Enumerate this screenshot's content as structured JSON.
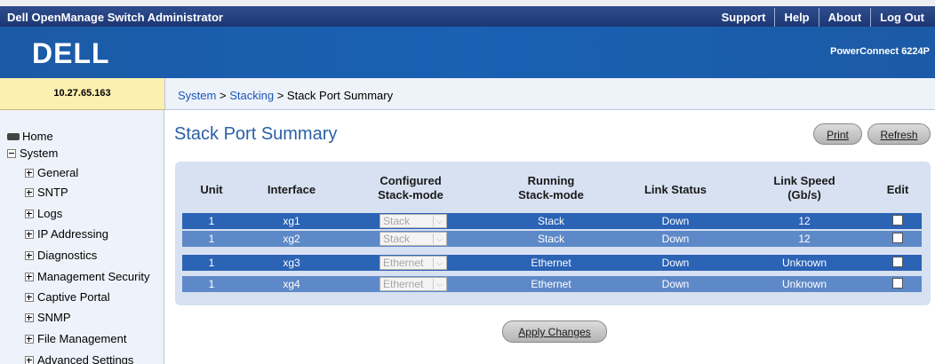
{
  "header": {
    "app_title": "Dell OpenManage Switch Administrator",
    "nav": [
      "Support",
      "Help",
      "About",
      "Log Out"
    ]
  },
  "banner": {
    "logo": "DELL",
    "model": "PowerConnect 6224P"
  },
  "ip_address": "10.27.65.163",
  "breadcrumb": [
    "System",
    "Stacking",
    "Stack Port Summary"
  ],
  "sidebar": {
    "items": [
      {
        "label": "Home",
        "icon": "home-icon"
      },
      {
        "label": "System",
        "icon": "collapse-icon"
      },
      {
        "label": "General",
        "icon": "expand-icon"
      },
      {
        "label": "SNTP",
        "icon": "expand-icon"
      },
      {
        "label": "Logs",
        "icon": "expand-icon"
      },
      {
        "label": "IP Addressing",
        "icon": "expand-icon"
      },
      {
        "label": "Diagnostics",
        "icon": "expand-icon"
      },
      {
        "label": "Management Security",
        "icon": "expand-icon"
      },
      {
        "label": "Captive Portal",
        "icon": "expand-icon"
      },
      {
        "label": "SNMP",
        "icon": "expand-icon"
      },
      {
        "label": "File Management",
        "icon": "expand-icon"
      },
      {
        "label": "Advanced Settings",
        "icon": "expand-icon"
      }
    ]
  },
  "main": {
    "title": "Stack Port Summary",
    "print_label": "Print",
    "refresh_label": "Refresh",
    "apply_label": "Apply Changes",
    "columns": {
      "unit": "Unit",
      "interface": "Interface",
      "configured_1": "Configured",
      "configured_2": "Stack-mode",
      "running_1": "Running",
      "running_2": "Stack-mode",
      "link_status": "Link Status",
      "link_speed_1": "Link Speed",
      "link_speed_2": "(Gb/s)",
      "edit": "Edit"
    },
    "rows": [
      {
        "unit": "1",
        "interface": "xg1",
        "configured": "Stack",
        "running": "Stack",
        "link_status": "Down",
        "link_speed": "12",
        "edit": false
      },
      {
        "unit": "1",
        "interface": "xg2",
        "configured": "Stack",
        "running": "Stack",
        "link_status": "Down",
        "link_speed": "12",
        "edit": false
      },
      {
        "unit": "1",
        "interface": "xg3",
        "configured": "Ethernet",
        "running": "Ethernet",
        "link_status": "Down",
        "link_speed": "Unknown",
        "edit": false
      },
      {
        "unit": "1",
        "interface": "xg4",
        "configured": "Ethernet",
        "running": "Ethernet",
        "link_status": "Down",
        "link_speed": "Unknown",
        "edit": false
      }
    ]
  },
  "colors": {
    "topbar": "#1c3673",
    "banner": "#1b5aa6",
    "ip_cell": "#fcf0b0",
    "row_dark": "#2b63b5",
    "row_light": "#5e89c8",
    "panel": "#d7e1f1",
    "title": "#2a5fa8"
  }
}
